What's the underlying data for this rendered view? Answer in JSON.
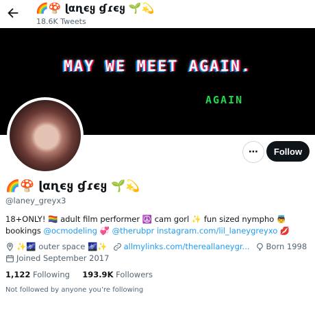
{
  "header": {
    "display_name": "🌈🍄 ɭαɳєყ ɠɾєყ 🌱💫",
    "tweet_count": "18.6K Tweets"
  },
  "banner": {
    "main_text": "MAY WE MEET AGAIN.",
    "glitch_text": "AGAIN"
  },
  "actions": {
    "more_label": "⋯",
    "follow_label": "Follow"
  },
  "profile": {
    "display_name": "🌈🍄 ɭαɳєყ ɠɾєყ 🌱💫",
    "handle": "@laney_greyx3",
    "bio_line1": "18+ONLY! 🏳️‍🌈 adult film performer ☮️ cam gorl ✨ fun sized nympho 👼 bookings",
    "bio_mention1": "@ocmodeling",
    "bio_emoji": " 💞 ",
    "bio_mention2": "@therubpr",
    "bio_link": "instagram.com/lil_laneygreyxo",
    "bio_end": " 💋",
    "location": "✨🌌 outer space 🌌✨",
    "website": "allmylinks.com/thereallaneygr...",
    "born": "Born 1998",
    "joined": "Joined September 2017"
  },
  "stats": {
    "following_count": "1,122",
    "following_label": "Following",
    "followers_count": "193.9K",
    "followers_label": "Followers"
  },
  "followers_you_know": "Not followed by anyone you’re following",
  "colors": {
    "accent_link": "#1d9bf0",
    "follow_button_bg": "#0f1419",
    "secondary_text": "#536471",
    "banner_bg": "#000000"
  }
}
